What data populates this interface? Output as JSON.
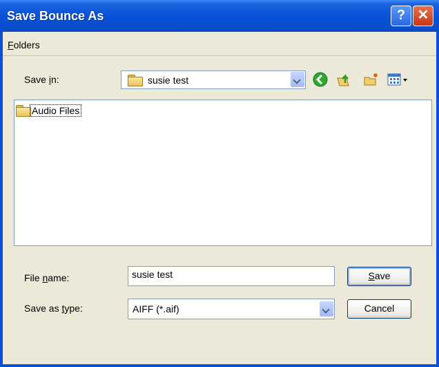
{
  "window": {
    "title": "Save Bounce As"
  },
  "menu": {
    "folders_first": "F",
    "folders_rest": "olders"
  },
  "save_in": {
    "label_pre": "Save ",
    "label_u": "i",
    "label_post": "n:",
    "value": "susie test"
  },
  "files": [
    {
      "name": "Audio Files",
      "type": "folder"
    }
  ],
  "file_name": {
    "label_pre": "File ",
    "label_u": "n",
    "label_post": "ame:",
    "value": "susie test"
  },
  "save_type": {
    "label_pre": "Save as ",
    "label_u": "t",
    "label_post": "ype:",
    "value": "AIFF (*.aif)"
  },
  "buttons": {
    "save_u": "S",
    "save_rest": "ave",
    "cancel": "Cancel"
  },
  "icons": {
    "help": "help-icon",
    "close": "close-icon",
    "back": "back-icon",
    "up": "up-folder-icon",
    "new_folder": "new-folder-icon",
    "views": "views-menu-icon"
  },
  "colors": {
    "titlebar": "#0a53d8",
    "dialog_bg": "#ece9d8",
    "close": "#c73612",
    "back_green": "#2fa82f"
  }
}
